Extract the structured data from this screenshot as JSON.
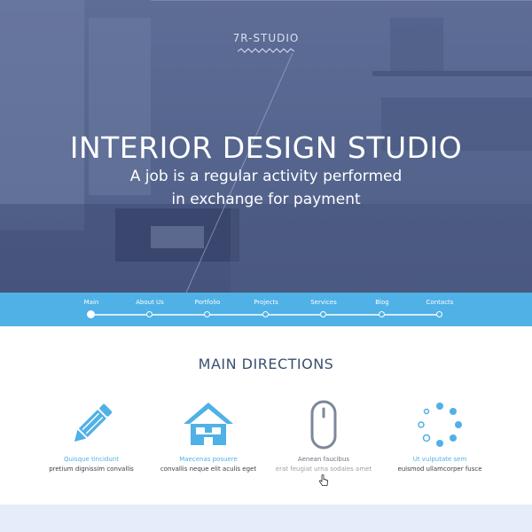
{
  "hero": {
    "logo": "7R-STUDIO",
    "title": "INTERIOR DESIGN STUDIO",
    "subtitle_line1": "A job is a regular activity performed",
    "subtitle_line2": "in exchange for payment"
  },
  "nav": {
    "items": [
      {
        "label": "Main",
        "active": true
      },
      {
        "label": "About Us"
      },
      {
        "label": "Portfolio"
      },
      {
        "label": "Projects"
      },
      {
        "label": "Services"
      },
      {
        "label": "Blog"
      },
      {
        "label": "Contacts"
      }
    ]
  },
  "section": {
    "title": "MAIN DIRECTIONS",
    "features": [
      {
        "icon": "pencil-icon",
        "title": "Quisque tincidunt",
        "text": "pretium dignissim convallis"
      },
      {
        "icon": "house-icon",
        "title": "Maecenas posuere",
        "text": "convallis neque elit aculis eget"
      },
      {
        "icon": "mouse-icon",
        "title": "Aenean faucibus",
        "text": "erat feugiat urna sodales amet"
      },
      {
        "icon": "loader-icon",
        "title": "Ut vulputate sem",
        "text": "euismod ullamcorper fusce"
      }
    ]
  },
  "colors": {
    "accent": "#4fb1e6",
    "heading": "#3a5070",
    "hero_overlay": "#56668f",
    "footer_band": "#e7ecfb"
  }
}
